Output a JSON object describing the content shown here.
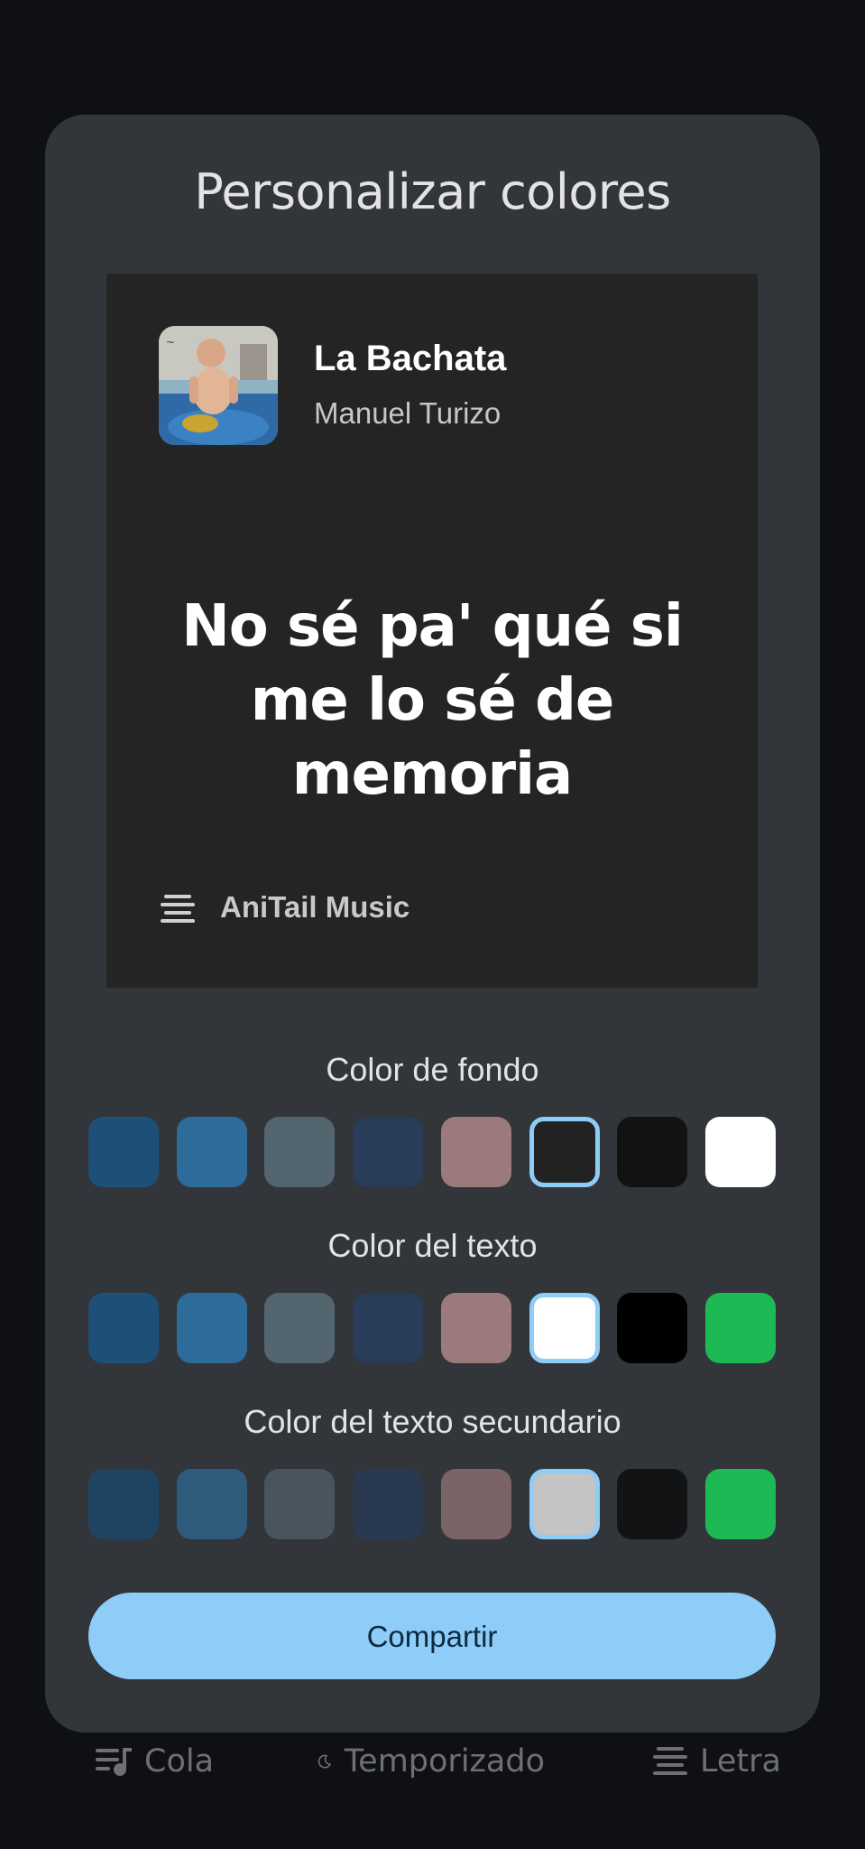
{
  "dialog": {
    "title": "Personalizar colores"
  },
  "preview": {
    "song_title": "La Bachata",
    "artist": "Manuel Turizo",
    "lyric": "No sé pa' qué si me lo sé de memoria",
    "brand": "AniTail Music",
    "background_color": "#242424"
  },
  "sections": {
    "background": {
      "label": "Color de fondo",
      "swatches": [
        "#1e5077",
        "#2d6c9a",
        "#536670",
        "#293d5a",
        "#9b7a7c",
        "#222222",
        "#121212",
        "#ffffff"
      ],
      "selected_index": 5
    },
    "text": {
      "label": "Color del texto",
      "swatches": [
        "#1e5077",
        "#2d6c9a",
        "#536670",
        "#293d5a",
        "#9b7a7c",
        "#ffffff",
        "#000000",
        "#1db954"
      ],
      "selected_index": 5
    },
    "secondary_text": {
      "label": "Color del texto secundario",
      "swatches": [
        "#1f4462",
        "#2f5b7d",
        "#4a545d",
        "#293a50",
        "#7b6466",
        "#c4c4c4",
        "#121315",
        "#1db954"
      ],
      "selected_index": 5
    }
  },
  "share_button": {
    "label": "Compartir"
  },
  "bottom_bar": {
    "queue_label": "Cola",
    "timer_label": "Temporizado",
    "lyrics_label": "Letra"
  },
  "accent_color": "#8ecdf7"
}
